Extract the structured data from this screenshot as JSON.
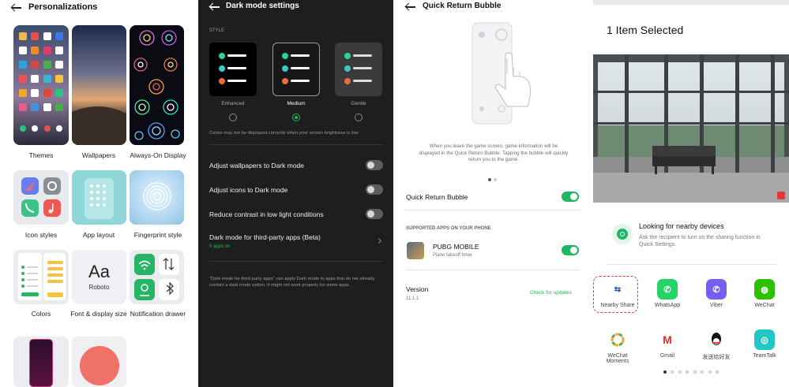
{
  "personalizations": {
    "title": "Personalizations",
    "tiles": [
      {
        "label": "Themes"
      },
      {
        "label": "Wallpapers"
      },
      {
        "label": "Always-On Display"
      },
      {
        "label": "Icon styles"
      },
      {
        "label": "App layout"
      },
      {
        "label": "Fingerprint style"
      },
      {
        "label": "Colors"
      },
      {
        "label": "Font & display size"
      },
      {
        "label": "Notification drawer"
      }
    ],
    "font_preview_big": "Aa",
    "font_preview_name": "Roboto"
  },
  "dark_mode": {
    "title": "Dark mode settings",
    "style_header": "STYLE",
    "styles": [
      {
        "label": "Enhanced",
        "selected": false
      },
      {
        "label": "Medium",
        "selected": true
      },
      {
        "label": "Gentle",
        "selected": false
      }
    ],
    "brightness_note": "Colors may not be displayed correctly when your screen brightness is low.",
    "rows": [
      {
        "label": "Adjust wallpapers to Dark mode",
        "on": false
      },
      {
        "label": "Adjust icons to Dark mode",
        "on": false
      },
      {
        "label": "Reduce contrast in low light conditions",
        "on": false
      }
    ],
    "third_party_label": "Dark mode for third-party apps (Beta)",
    "third_party_sub": "0 apps on",
    "footnote": "\"Dark mode for third-party apps\" can apply Dark mode to apps that do not already contain a dark mode option. It might not work properly for some apps."
  },
  "quick_return": {
    "title": "Quick Return Bubble",
    "description": "When you leave the game screen, game information will be displayed in the Quick Return Bubble. Tapping the bubble will quickly return you to the game.",
    "toggle_label": "Quick Return Bubble",
    "toggle_on": true,
    "supported_header": "SUPPORTED APPS ON YOUR PHONE",
    "app_name": "PUBG MOBILE",
    "app_sub": "Plane takeoff timer",
    "app_on": true,
    "version_label": "Version",
    "version_value": "11.1.1",
    "check_updates": "Check for updates"
  },
  "share": {
    "title": "1 Item Selected",
    "nearby_title": "Looking for nearby devices",
    "nearby_sub": "Ask the recipient to turn on the sharing function in Quick Settings.",
    "apps": [
      {
        "label": "Nearby Share",
        "icon": "nearby-share-icon"
      },
      {
        "label": "WhatsApp",
        "icon": "whatsapp-icon"
      },
      {
        "label": "Viber",
        "icon": "viber-icon"
      },
      {
        "label": "WeChat",
        "icon": "wechat-icon"
      },
      {
        "label": "WeChat Moments",
        "icon": "moments-icon"
      },
      {
        "label": "Gmail",
        "icon": "gmail-icon"
      },
      {
        "label": "发送给好友",
        "icon": "qq-icon"
      },
      {
        "label": "TeamTalk",
        "icon": "teamtalk-icon"
      }
    ]
  },
  "colors": {
    "accent_green": "#1fb75f",
    "dark_bg": "#1e1e1e"
  }
}
